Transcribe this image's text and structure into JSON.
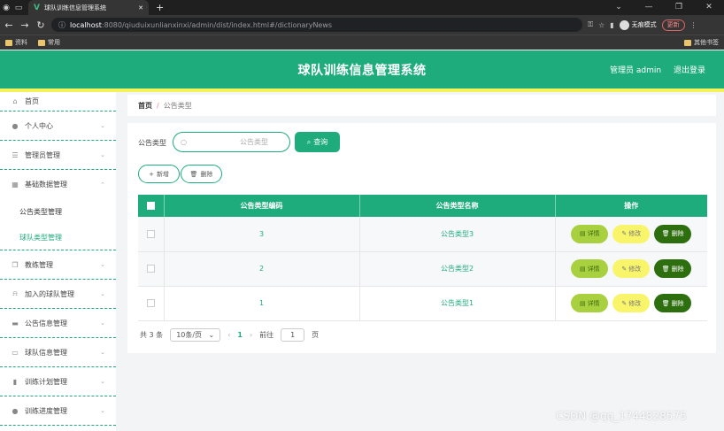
{
  "browser": {
    "tab_title": "球队训练信息管理系统",
    "url_host": "localhost",
    "url_path": ":8080/qiuduixunlianxinxi/admin/dist/index.html#/dictionaryNews",
    "incognito_label": "无痕模式",
    "update_label": "更新",
    "bookmarks": [
      "资料",
      "常用"
    ],
    "bookmarks_right": "其他书签"
  },
  "header": {
    "title": "球队训练信息管理系统",
    "user": "管理员 admin",
    "logout": "退出登录"
  },
  "sidebar": {
    "items": [
      {
        "label": "首页",
        "icon": "home-icon"
      },
      {
        "label": "个人中心",
        "icon": "user-icon"
      },
      {
        "label": "管理员管理",
        "icon": "list-icon"
      },
      {
        "label": "基础数据管理",
        "icon": "grid-icon"
      },
      {
        "label": "公告类型管理"
      },
      {
        "label": "球队类型管理"
      },
      {
        "label": "教练管理",
        "icon": "copy-icon"
      },
      {
        "label": "加入的球队管理",
        "icon": "bell-icon"
      },
      {
        "label": "公告信息管理",
        "icon": "message-icon"
      },
      {
        "label": "球队信息管理",
        "icon": "chat-icon"
      },
      {
        "label": "训练计划管理",
        "icon": "chart-icon"
      },
      {
        "label": "训练进度管理",
        "icon": "user-icon"
      }
    ]
  },
  "breadcrumb": {
    "home": "首页",
    "separator": "/",
    "current": "公告类型"
  },
  "search": {
    "label": "公告类型",
    "placeholder": "公告类型",
    "button": "查询"
  },
  "actions": {
    "add": "新增",
    "delete": "删除"
  },
  "table": {
    "headers": [
      "公告类型编码",
      "公告类型名称",
      "操作"
    ],
    "rows": [
      {
        "code": "3",
        "name": "公告类型3"
      },
      {
        "code": "2",
        "name": "公告类型2"
      },
      {
        "code": "1",
        "name": "公告类型1"
      }
    ],
    "ops": {
      "detail": "详情",
      "edit": "修改",
      "remove": "删除"
    }
  },
  "pagination": {
    "total": "共 3 条",
    "page_size": "10条/页",
    "current_page": "1",
    "goto_label": "前往",
    "goto_value": "1",
    "page_suffix": "页"
  },
  "watermark": "CSDN @qq_1744828575"
}
